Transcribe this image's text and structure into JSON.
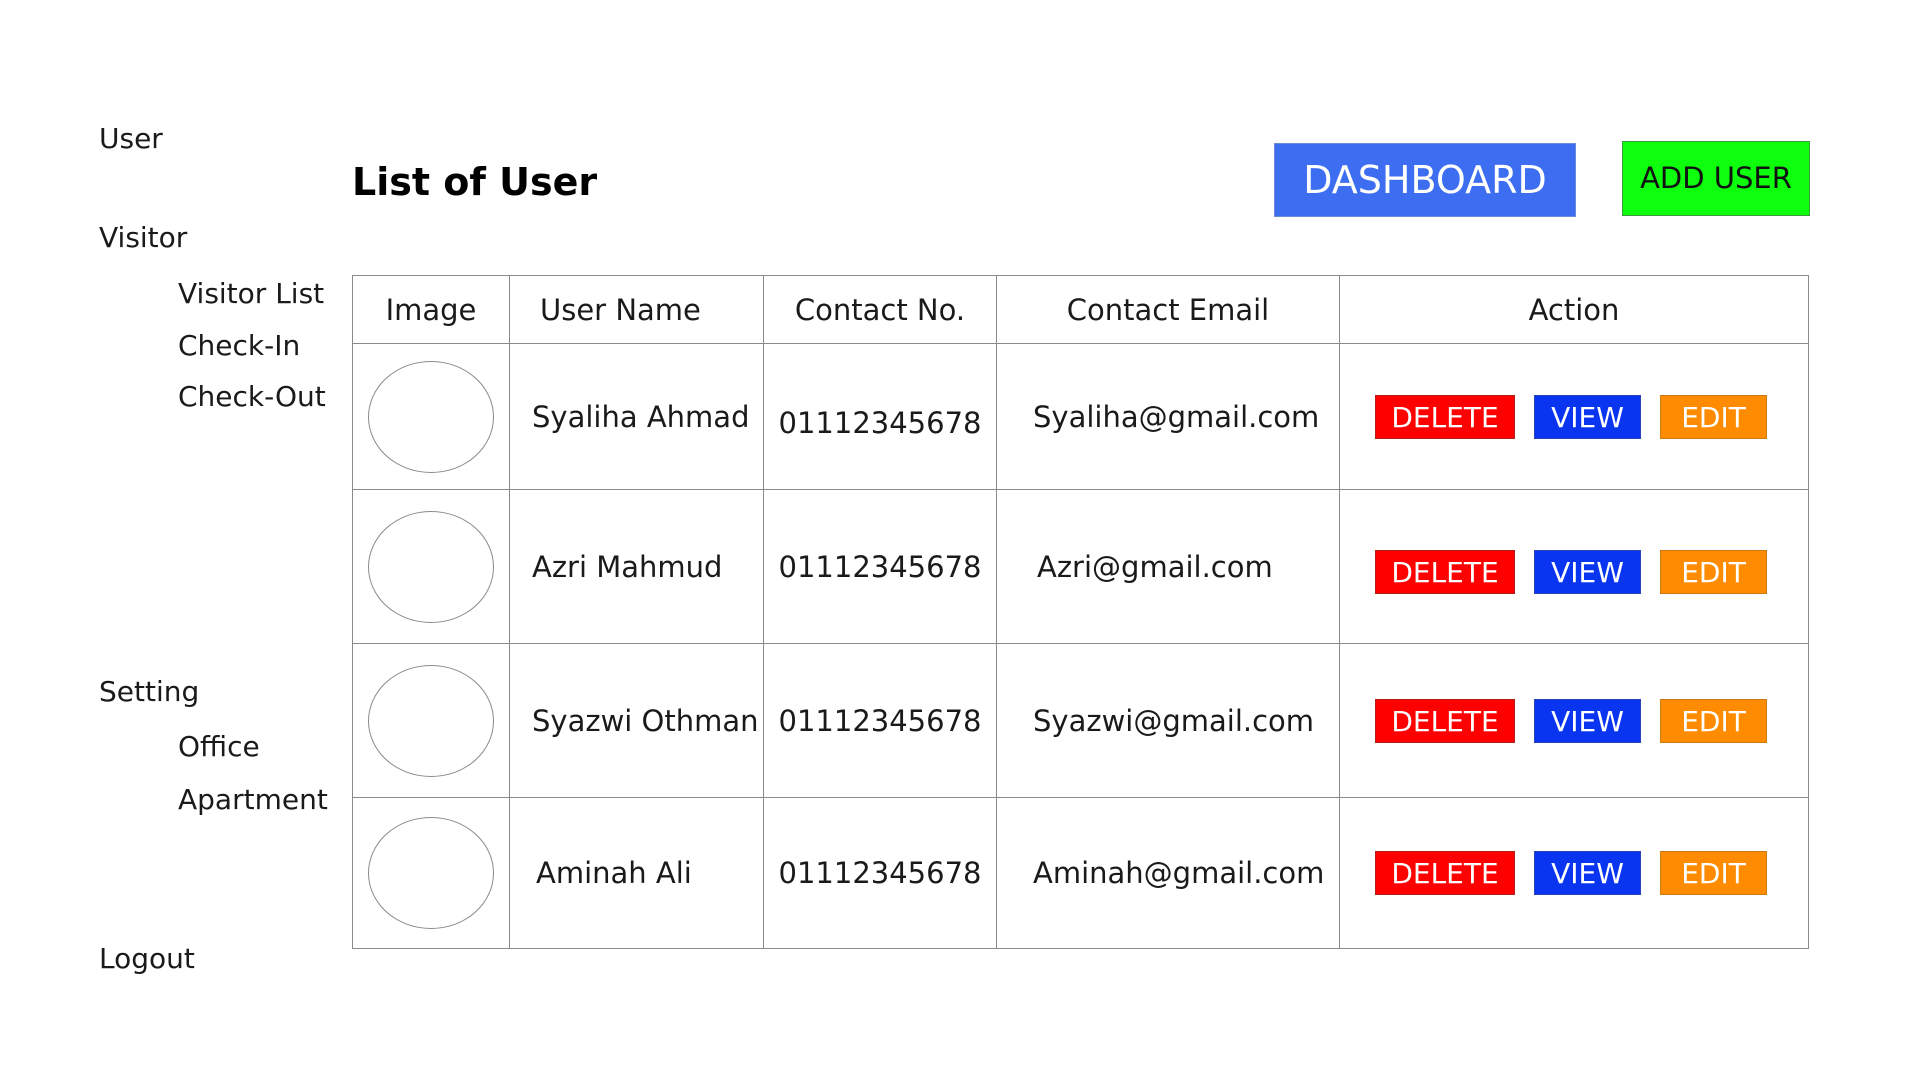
{
  "sidebar": {
    "user": "User",
    "visitor": "Visitor",
    "visitor_list": "Visitor List",
    "check_in": "Check-In",
    "check_out": "Check-Out",
    "setting": "Setting",
    "office": "Office",
    "apartment": "Apartment",
    "logout": "Logout"
  },
  "header": {
    "title": "List of User",
    "dashboard_label": "DASHBOARD",
    "add_user_label": "ADD USER"
  },
  "table": {
    "columns": {
      "image": "Image",
      "user_name": "User Name",
      "contact_no": "Contact No.",
      "contact_email": "Contact Email",
      "action": "Action"
    },
    "rows": [
      {
        "name": "Syaliha Ahmad",
        "phone": "01112345678",
        "email": "Syaliha@gmail.com"
      },
      {
        "name": "Azri Mahmud",
        "phone": "01112345678",
        "email": "Azri@gmail.com"
      },
      {
        "name": "Syazwi Othman",
        "phone": "01112345678",
        "email": "Syazwi@gmail.com"
      },
      {
        "name": "Aminah Ali",
        "phone": "01112345678",
        "email": "Aminah@gmail.com"
      }
    ],
    "actions": {
      "delete": "DELETE",
      "view": "VIEW",
      "edit": "EDIT"
    }
  },
  "colors": {
    "dashboard": "#3d6ef2",
    "add_user": "#0dff0d",
    "delete": "#ff0000",
    "view": "#0a35f0",
    "edit": "#ff8c00"
  }
}
